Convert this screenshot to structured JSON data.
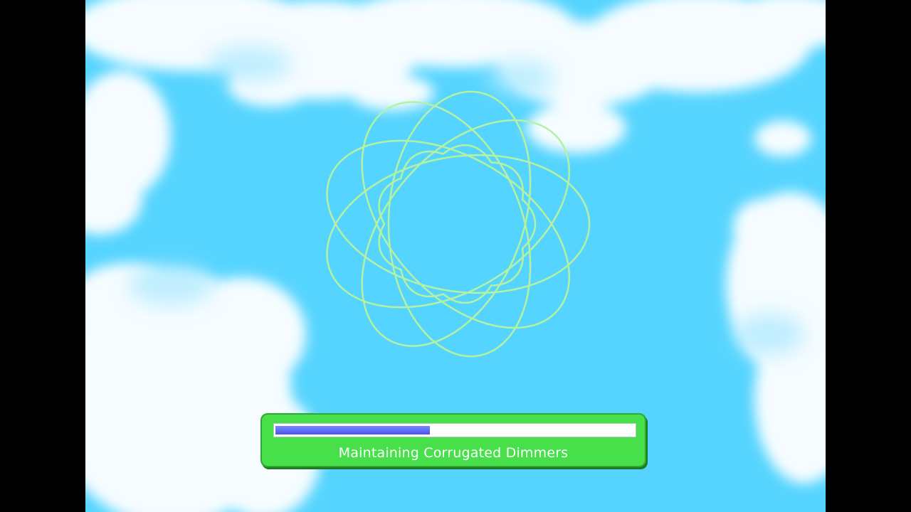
{
  "loading": {
    "message": "Maintaining Corrugated Dimmers",
    "progress": 0.43
  },
  "colors": {
    "sky": "#55d4ff",
    "cloud": "#ffffff",
    "spirograph": "#b4f2a2",
    "panel": "#47e04a",
    "progress_fill": "#4a55ee",
    "progress_track": "#ffffff",
    "letterbox": "#000000"
  },
  "icons": {
    "loading_graphic": "spirograph-icon"
  }
}
